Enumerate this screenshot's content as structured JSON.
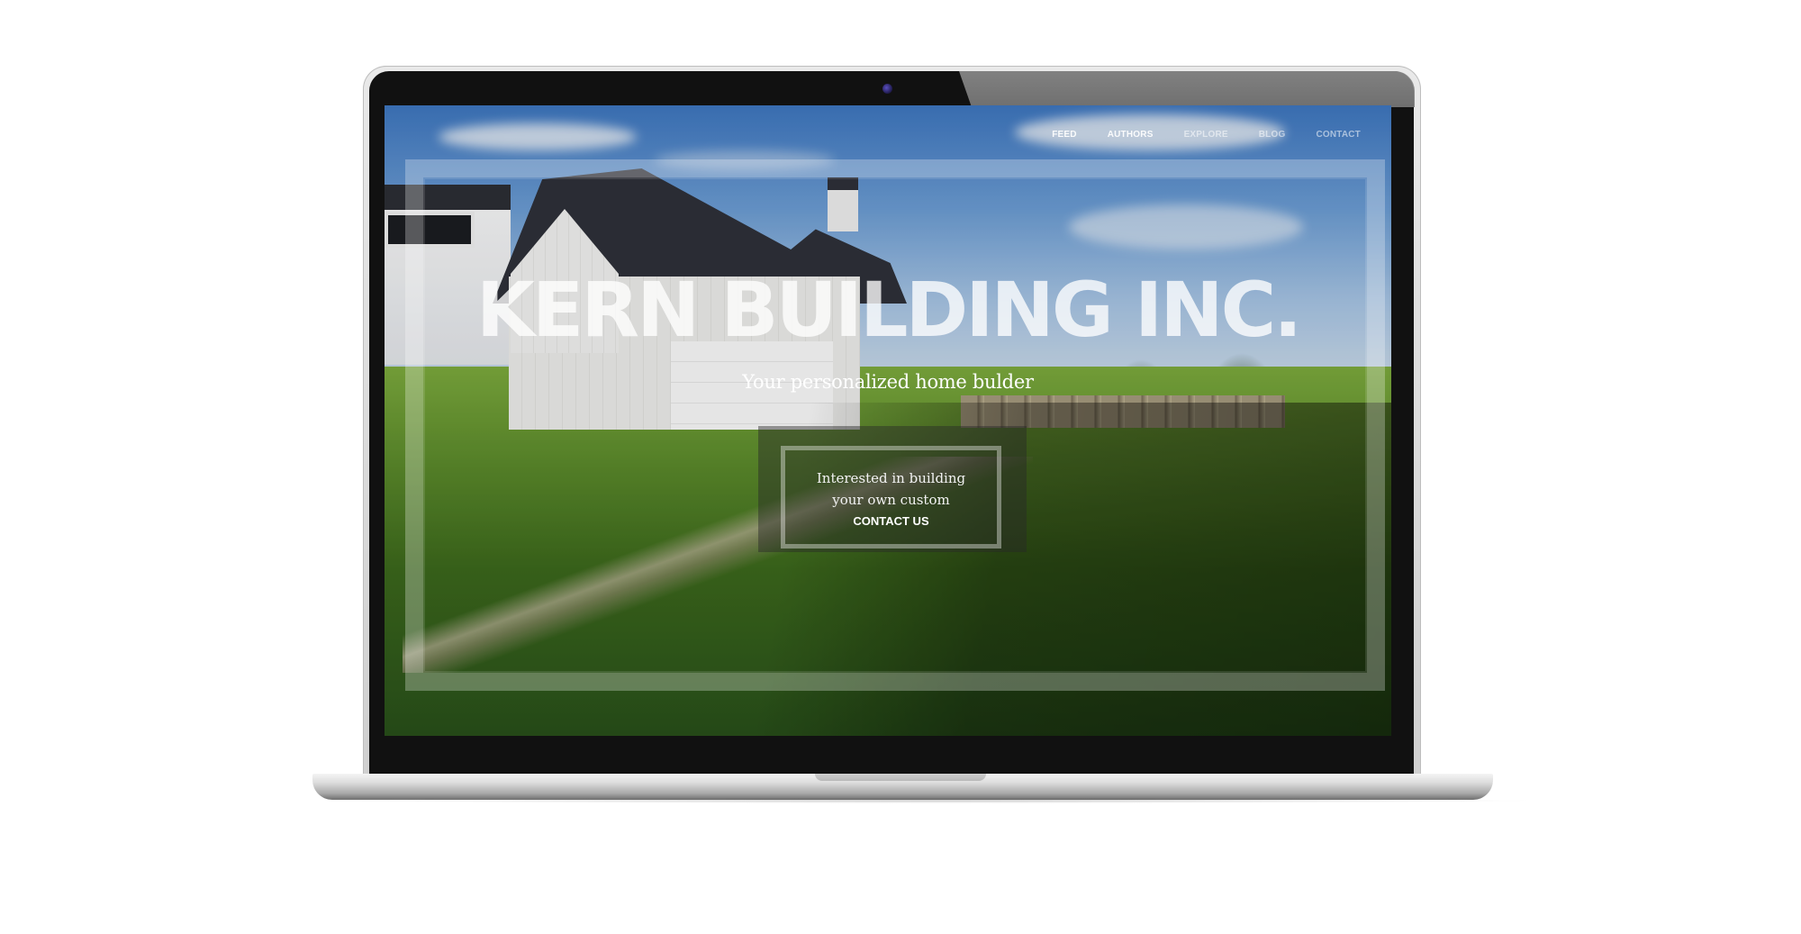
{
  "site": {
    "nav": [
      {
        "label": "FEED"
      },
      {
        "label": "AUTHORS"
      },
      {
        "label": "EXPLORE"
      },
      {
        "label": "BLOG"
      },
      {
        "label": "CONTACT"
      }
    ],
    "hero": {
      "title": "KERN BUILDING INC.",
      "subtitle": "Your personalized home bulder"
    },
    "cta": {
      "line1": "Interested in building",
      "line2": "your own custom",
      "link": "CONTACT US"
    }
  },
  "colors": {
    "device_bezel": "#111111",
    "device_shell": "#d9d9d9",
    "camera": "#3a338c"
  }
}
